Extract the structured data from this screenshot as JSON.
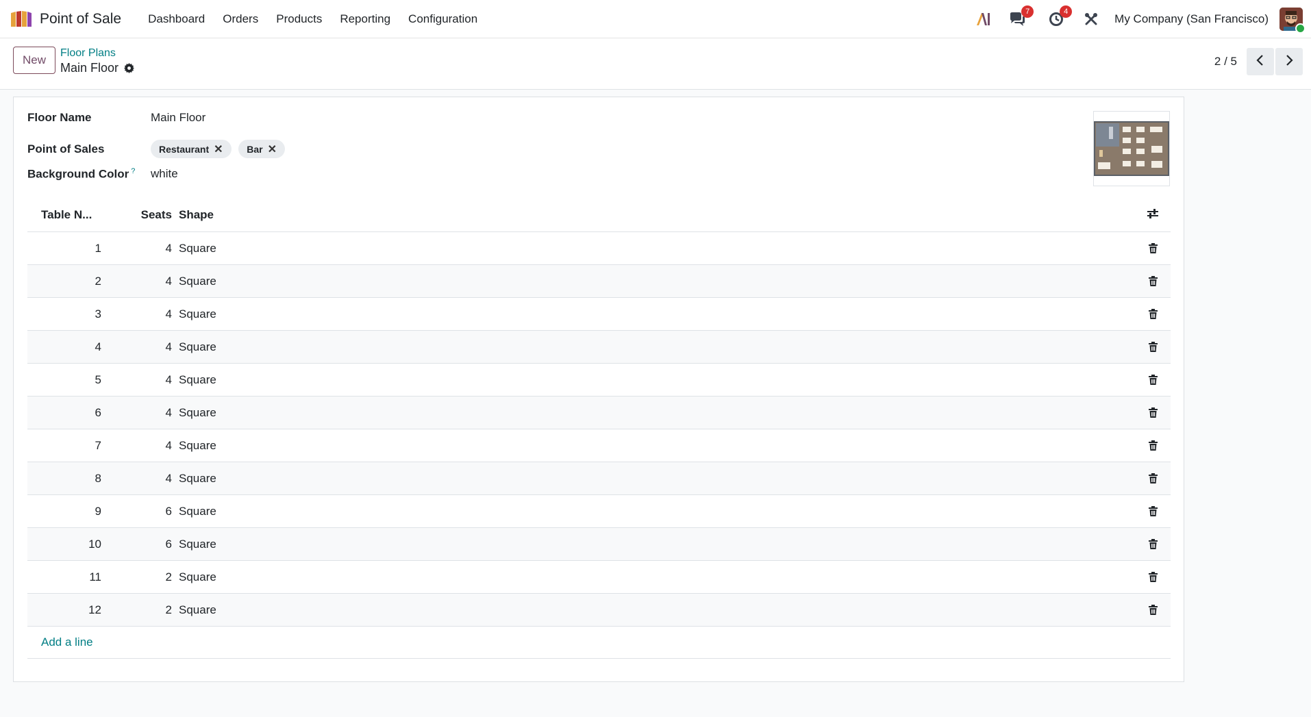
{
  "navbar": {
    "app_name": "Point of Sale",
    "menu": [
      "Dashboard",
      "Orders",
      "Products",
      "Reporting",
      "Configuration"
    ],
    "messages_count": "7",
    "activities_count": "4",
    "company": "My Company (San Francisco)"
  },
  "control": {
    "new_label": "New",
    "breadcrumb_parent": "Floor Plans",
    "breadcrumb_current": "Main Floor",
    "pager": "2 / 5"
  },
  "form": {
    "floor_name_label": "Floor Name",
    "floor_name_value": "Main Floor",
    "pos_label": "Point of Sales",
    "pos_tags": [
      "Restaurant",
      "Bar"
    ],
    "bg_color_label": "Background Color",
    "bg_color_help": "?",
    "bg_color_value": "white"
  },
  "table": {
    "headers": {
      "number": "Table N...",
      "seats": "Seats",
      "shape": "Shape"
    },
    "rows": [
      {
        "number": "1",
        "seats": "4",
        "shape": "Square"
      },
      {
        "number": "2",
        "seats": "4",
        "shape": "Square"
      },
      {
        "number": "3",
        "seats": "4",
        "shape": "Square"
      },
      {
        "number": "4",
        "seats": "4",
        "shape": "Square"
      },
      {
        "number": "5",
        "seats": "4",
        "shape": "Square"
      },
      {
        "number": "6",
        "seats": "4",
        "shape": "Square"
      },
      {
        "number": "7",
        "seats": "4",
        "shape": "Square"
      },
      {
        "number": "8",
        "seats": "4",
        "shape": "Square"
      },
      {
        "number": "9",
        "seats": "6",
        "shape": "Square"
      },
      {
        "number": "10",
        "seats": "6",
        "shape": "Square"
      },
      {
        "number": "11",
        "seats": "2",
        "shape": "Square"
      },
      {
        "number": "12",
        "seats": "2",
        "shape": "Square"
      }
    ],
    "add_line": "Add a line"
  },
  "colors": {
    "brand": "#714B67",
    "link": "#017e84",
    "badge": "#d9302f"
  },
  "icons": {
    "app": "pos-logo-icon",
    "ai": "ai-icon",
    "chat": "chat-icon",
    "activity": "clock-icon",
    "debug": "tools-icon",
    "settings": "gear-icon",
    "prev": "chevron-left-icon",
    "next": "chevron-right-icon",
    "optional_columns": "sliders-icon",
    "delete": "trash-icon",
    "remove_tag": "close-icon"
  }
}
